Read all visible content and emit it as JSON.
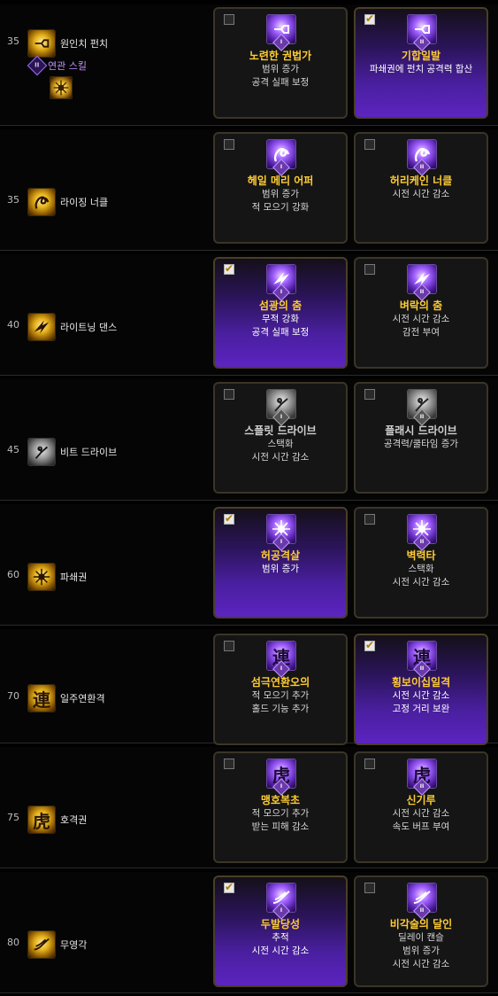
{
  "rows": [
    {
      "level": "35",
      "name": "원인치 펀치",
      "related_label": "연관 스킬",
      "related_badge": "II",
      "icon": "fist-punch-icon",
      "left": {
        "name": "노련한 권법가",
        "tier": "I",
        "checked": false,
        "lines": [
          "범위 증가",
          "공격 실패 보정"
        ]
      },
      "right": {
        "name": "기합일발",
        "tier": "II",
        "checked": true,
        "lines": [
          "파쇄권에 펀치 공격력 합산"
        ]
      }
    },
    {
      "level": "35",
      "name": "라이징 너클",
      "icon": "rising-knuckle-icon",
      "left": {
        "name": "헤일 메리 어퍼",
        "tier": "I",
        "checked": false,
        "lines": [
          "범위 증가",
          "적 모으기 강화"
        ]
      },
      "right": {
        "name": "허리케인 너클",
        "tier": "II",
        "checked": false,
        "lines": [
          "시전 시간 감소"
        ]
      }
    },
    {
      "level": "40",
      "name": "라이트닝 댄스",
      "icon": "lightning-dance-icon",
      "left": {
        "name": "섬광의 춤",
        "tier": "I",
        "checked": true,
        "lines": [
          "무적 강화",
          "공격 실패 보정"
        ]
      },
      "right": {
        "name": "벼락의 춤",
        "tier": "II",
        "checked": false,
        "lines": [
          "시전 시간 감소",
          "감전 부여"
        ]
      }
    },
    {
      "level": "45",
      "name": "비트 드라이브",
      "icon": "beat-drive-icon",
      "left": {
        "name": "스플릿 드라이브",
        "tier": "I",
        "checked": false,
        "lines": [
          "스택화",
          "시전 시간 감소"
        ]
      },
      "right": {
        "name": "플래시 드라이브",
        "tier": "II",
        "checked": false,
        "lines": [
          "공격력/쿨타임 증가"
        ]
      }
    },
    {
      "level": "60",
      "name": "파쇄권",
      "icon": "shatter-fist-icon",
      "left": {
        "name": "허공격살",
        "tier": "I",
        "checked": true,
        "lines": [
          "범위 증가"
        ]
      },
      "right": {
        "name": "벽력타",
        "tier": "II",
        "checked": false,
        "lines": [
          "스택화",
          "시전 시간 감소"
        ]
      }
    },
    {
      "level": "70",
      "name": "일주연환격",
      "icon": "chain-strike-icon",
      "glyph": "連",
      "left": {
        "name": "섬극연환오의",
        "tier": "I",
        "checked": false,
        "lines": [
          "적 모으기 추가",
          "홀드 기능 추가"
        ]
      },
      "right": {
        "name": "횡보이십일격",
        "tier": "II",
        "checked": true,
        "lines": [
          "시전 시간 감소",
          "고정 거리 보완"
        ]
      }
    },
    {
      "level": "75",
      "name": "호격권",
      "icon": "tiger-fist-icon",
      "glyph": "虎",
      "left": {
        "name": "맹호복초",
        "tier": "I",
        "checked": false,
        "lines": [
          "적 모으기 추가",
          "받는 피해 감소"
        ]
      },
      "right": {
        "name": "신기루",
        "tier": "II",
        "checked": false,
        "lines": [
          "시전 시간 감소",
          "속도 버프 부여"
        ]
      }
    },
    {
      "level": "80",
      "name": "무영각",
      "icon": "shadowless-kick-icon",
      "left": {
        "name": "두발당성",
        "tier": "I",
        "checked": true,
        "lines": [
          "추적",
          "시전 시간 감소"
        ]
      },
      "right": {
        "name": "비각술의 달인",
        "tier": "II",
        "checked": false,
        "lines": [
          "딜레이 캔슬",
          "범위 증가",
          "시전 시간 감소"
        ]
      }
    }
  ],
  "colors": {
    "accent": "#ffcc33",
    "selected_purple": "#5c24c0",
    "related": "#c390ff"
  }
}
